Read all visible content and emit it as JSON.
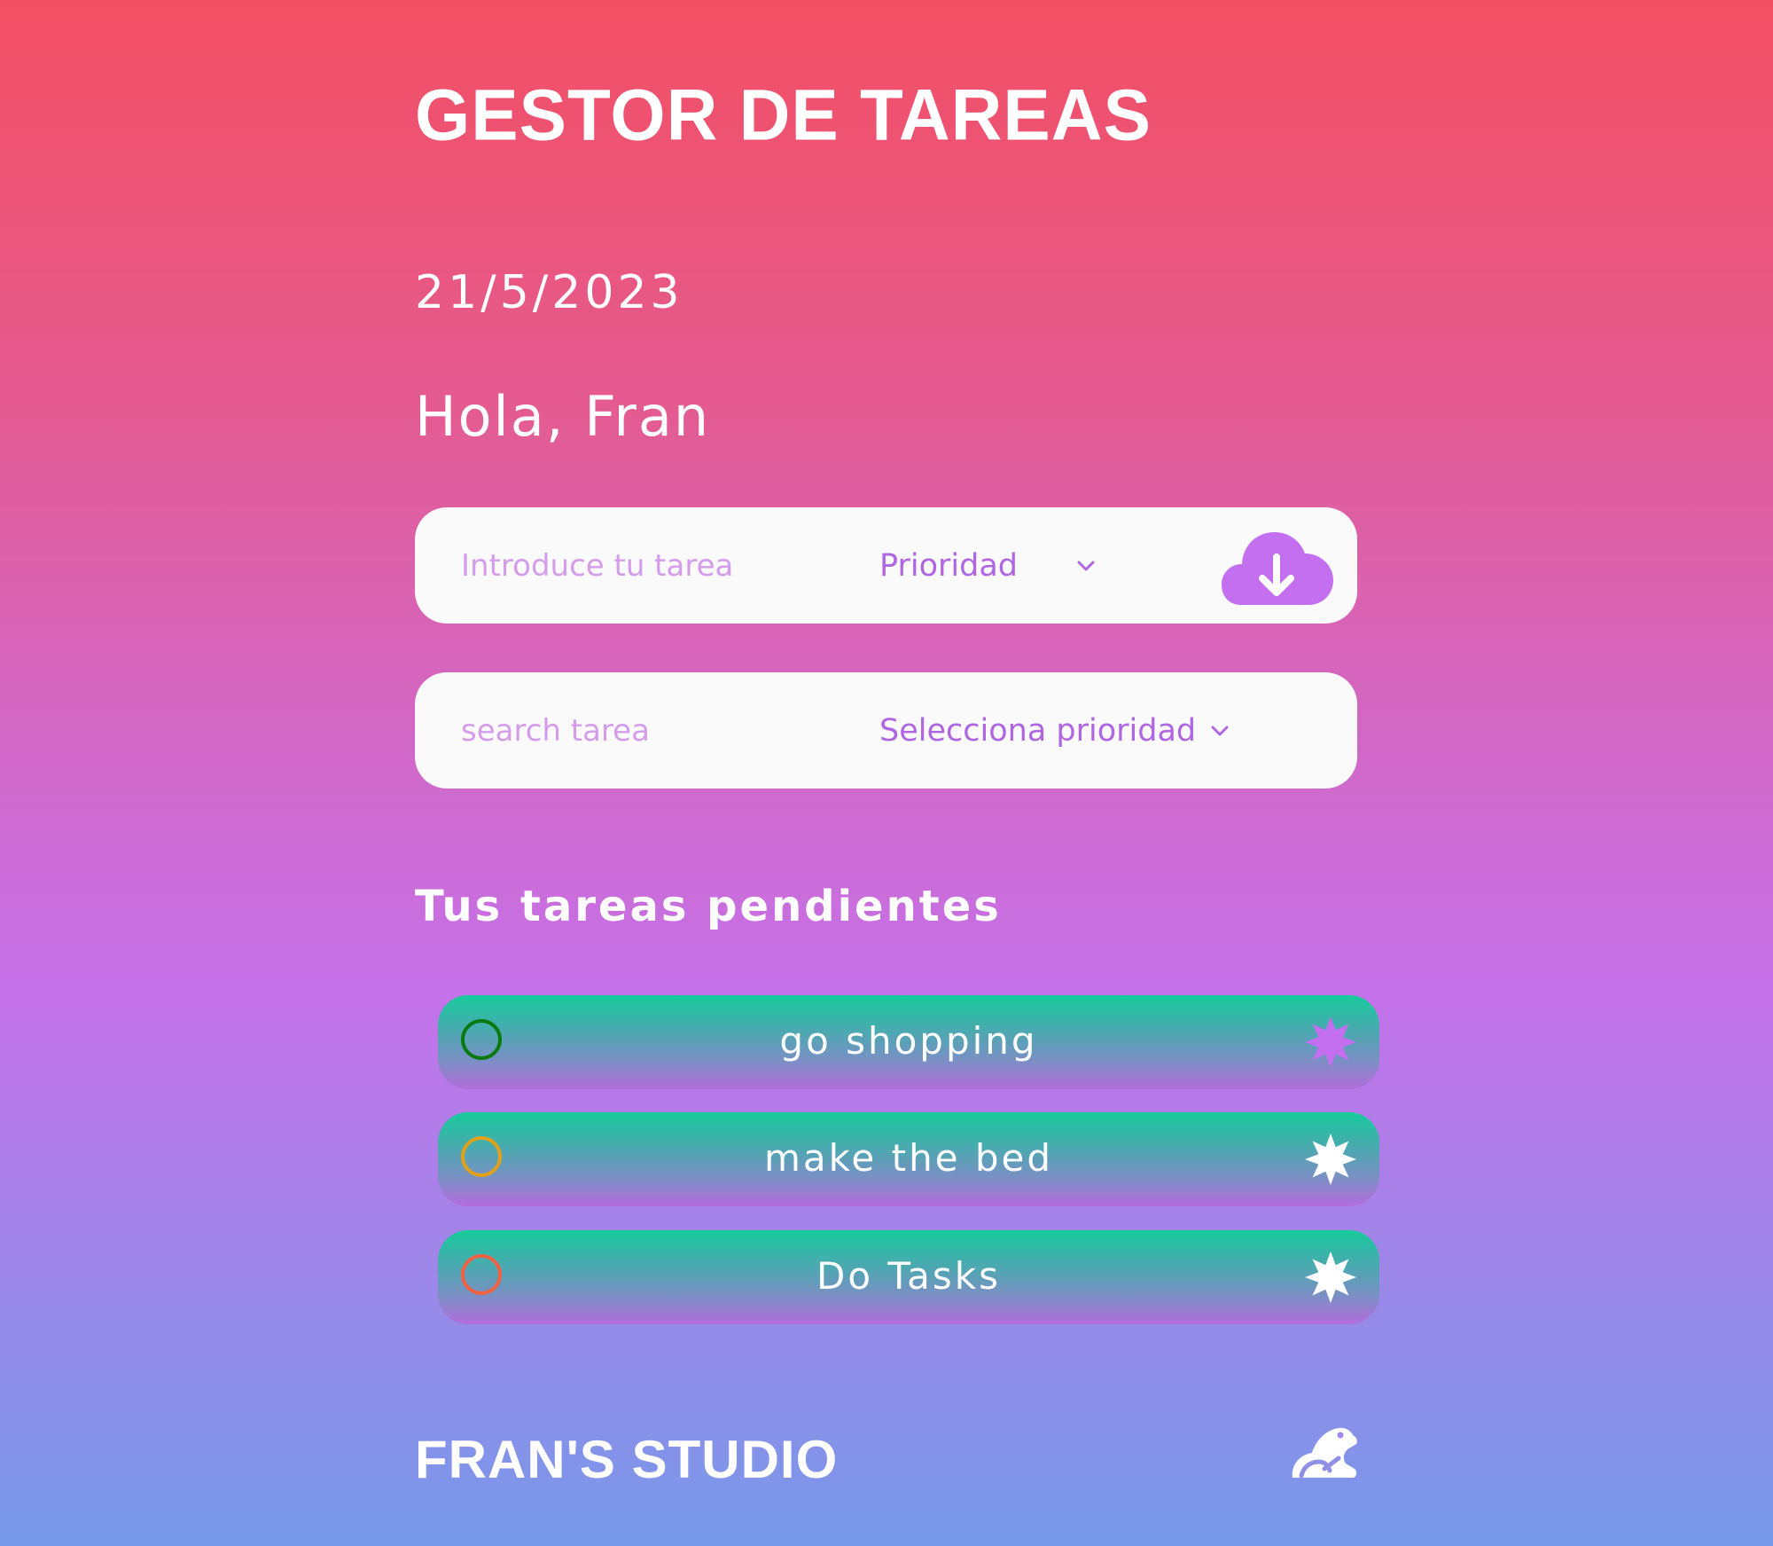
{
  "header": {
    "title": "GESTOR DE TAREAS"
  },
  "date": "21/5/2023",
  "greeting": "Hola, Fran",
  "add_form": {
    "task_placeholder": "Introduce tu tarea",
    "priority_label": "Prioridad",
    "submit_icon": "cloud-download-icon"
  },
  "search_form": {
    "search_placeholder": "search tarea",
    "priority_filter_label": "Selecciona prioridad"
  },
  "tasks_section": {
    "title": "Tus tareas pendientes",
    "tasks": [
      {
        "text": "go shopping",
        "priority_color": "#0a7a10",
        "star_color": "#c36ff0"
      },
      {
        "text": "make the bed",
        "priority_color": "#e0a11a",
        "star_color": "#ffffff"
      },
      {
        "text": "Do Tasks",
        "priority_color": "#f06043",
        "star_color": "#ffffff"
      }
    ]
  },
  "footer": {
    "brand": "FRAN'S STUDIO",
    "logo_icon": "frog-icon"
  },
  "colors": {
    "accent": "#c36ff0",
    "task_gradient_top": "#17cb9c",
    "task_gradient_bottom": "#b46cdc"
  }
}
